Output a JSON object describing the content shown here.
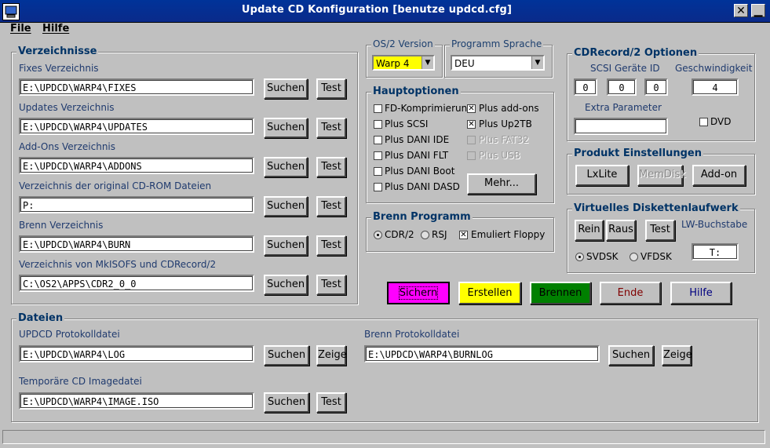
{
  "window": {
    "title": "Update CD Konfiguration [benutze updcd.cfg]",
    "close_glyph": "✕",
    "min_glyph": "▁"
  },
  "menu": {
    "file": "File",
    "hilfe": "Hilfe"
  },
  "verzeichnisse": {
    "title": "Verzeichnisse",
    "rows": [
      {
        "label": "Fixes Verzeichnis",
        "value": "E:\\UPDCD\\WARP4\\FIXES",
        "btn1": "Suchen",
        "btn2": "Test"
      },
      {
        "label": "Updates Verzeichnis",
        "value": "E:\\UPDCD\\WARP4\\UPDATES",
        "btn1": "Suchen",
        "btn2": "Test"
      },
      {
        "label": "Add-Ons Verzeichnis",
        "value": "E:\\UPDCD\\WARP4\\ADDONS",
        "btn1": "Suchen",
        "btn2": "Test"
      },
      {
        "label": "Verzeichnis der original CD-ROM Dateien",
        "value": "P:",
        "btn1": "Suchen",
        "btn2": "Test"
      },
      {
        "label": "Brenn Verzeichnis",
        "value": "E:\\UPDCD\\WARP4\\BURN",
        "btn1": "Suchen",
        "btn2": "Test"
      },
      {
        "label": "Verzeichnis von MkISOFS und CDRecord/2",
        "value": "C:\\OS2\\APPS\\CDR2_0_0",
        "btn1": "Suchen",
        "btn2": "Test"
      }
    ]
  },
  "os2": {
    "title": "OS/2 Version",
    "value": "Warp 4",
    "color": "#ffff00"
  },
  "sprache": {
    "title": "Programm Sprache",
    "value": "DEU"
  },
  "hauptoptionen": {
    "title": "Hauptoptionen",
    "left": [
      {
        "label": "FD-Komprimierun",
        "checked": false
      },
      {
        "label": "Plus SCSI",
        "checked": false
      },
      {
        "label": "Plus DANI IDE",
        "checked": false
      },
      {
        "label": "Plus DANI FLT",
        "checked": false
      },
      {
        "label": "Plus DANI Boot",
        "checked": false
      },
      {
        "label": "Plus DANI DASD",
        "checked": false
      }
    ],
    "right": [
      {
        "label": "Plus add-ons",
        "checked": true,
        "disabled": false
      },
      {
        "label": "Plus Up2TB",
        "checked": true,
        "disabled": false
      },
      {
        "label": "Plus FAT32",
        "checked": false,
        "disabled": true
      },
      {
        "label": "Plus USB",
        "checked": false,
        "disabled": true
      }
    ],
    "mehr": "Mehr..."
  },
  "brenn": {
    "title": "Brenn Programm",
    "cdr2": "CDR/2",
    "rsj": "RSJ",
    "emuliert": "Emuliert Floppy"
  },
  "cdrecord": {
    "title": "CDRecord/2 Optionen",
    "scsi_label": "SCSI Geräte ID",
    "scsi": [
      "0",
      "0",
      "0"
    ],
    "speed_label": "Geschwindigkeit",
    "speed": "4",
    "extra_label": "Extra Parameter",
    "extra": "",
    "dvd": "DVD"
  },
  "produkt": {
    "title": "Produkt Einstellungen",
    "lxlite": "LxLite",
    "memdisk": "MemDisk",
    "addon": "Add-on"
  },
  "virtuell": {
    "title": "Virtuelles Diskettenlaufwerk",
    "rein": "Rein",
    "raus": "Raus",
    "test": "Test",
    "lw_label": "LW-Buchstabe",
    "lw": "T:",
    "svdsk": "SVDSK",
    "vfdsk": "VFDSK"
  },
  "actions": {
    "sichern": "Sichern",
    "sichern_color": "#ff00ff",
    "erstellen": "Erstellen",
    "erstellen_color": "#ffff00",
    "brennen": "Brennen",
    "brennen_color": "#008000",
    "ende": "Ende",
    "ende_color": "#800000",
    "hilfe": "Hilfe",
    "hilfe_color": "#000080"
  },
  "dateien": {
    "title": "Dateien",
    "upd_label": "UPDCD Protokolldatei",
    "upd": "E:\\UPDCD\\WARP4\\LOG",
    "upd_b1": "Suchen",
    "upd_b2": "Zeige",
    "img_label": "Temporäre CD Imagedatei",
    "img": "E:\\UPDCD\\WARP4\\IMAGE.ISO",
    "img_b1": "Suchen",
    "img_b2": "Test",
    "burn_label": "Brenn Protokolldatei",
    "burn": "E:\\UPDCD\\WARP4\\BURNLOG",
    "burn_b1": "Suchen",
    "burn_b2": "Zeige"
  }
}
